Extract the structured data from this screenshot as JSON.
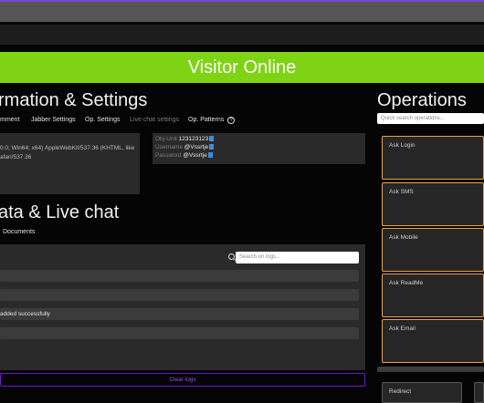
{
  "banner": {
    "title": "Visitor Online"
  },
  "info": {
    "heading": "rmation & Settings",
    "tabs": [
      "mment",
      "Jabber Settings",
      "Op. Settings",
      "Live chat settings",
      "Op. Patterns"
    ],
    "ua_line1": "0.0; Win64; x64) AppleWebKit/537.36 (KHTML, like",
    "ua_line2": "afari/537.36",
    "fields": [
      {
        "key": "Obj-Unit",
        "value": "123123123"
      },
      {
        "key": "Username",
        "value": "@Vssrtje"
      },
      {
        "key": "Password",
        "value": "@Vssrtje"
      }
    ]
  },
  "data": {
    "heading": "ata & Live chat",
    "tab": "Documents",
    "search_placeholder": "Search on logs...",
    "logs": [
      "",
      "",
      "added successfully",
      ""
    ],
    "clear_label": "Clear logs"
  },
  "ops": {
    "heading": "Operations",
    "search_placeholder": "Quick search operations...",
    "cards": [
      "Ask Login",
      "Ask SMS",
      "Ask Mobile",
      "Ask ReadMe",
      "Ask Email"
    ],
    "bottom": [
      "Redirect"
    ]
  },
  "colors": {
    "accent": "#7ed314",
    "card_border": "#e6a34a",
    "clear_border": "#6a1bc7"
  }
}
